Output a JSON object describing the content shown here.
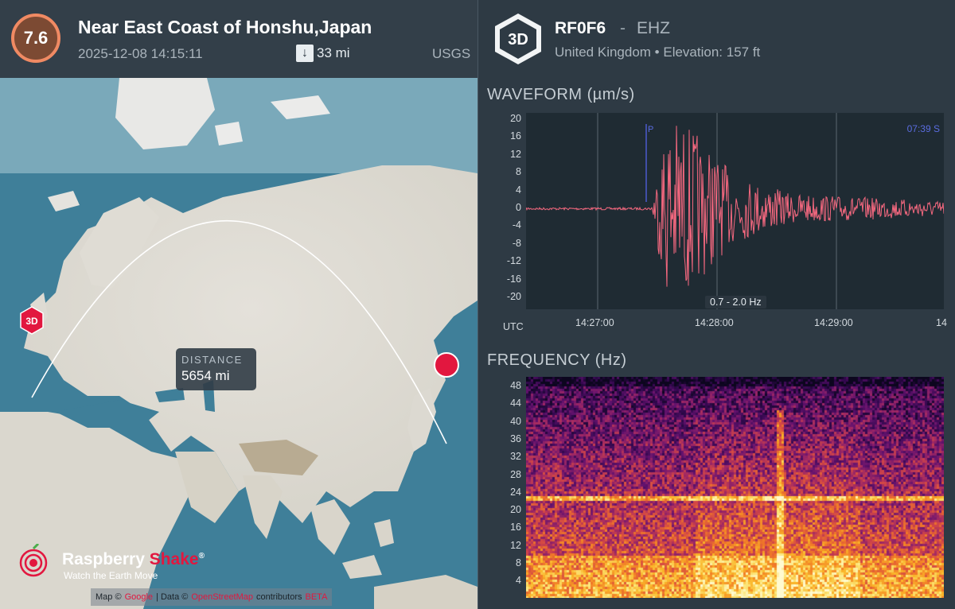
{
  "quake": {
    "magnitude": "7.6",
    "title": "Near East Coast of Honshu,Japan",
    "time": "2025-12-08 14:15:11",
    "depth": "33 mi",
    "depth_icon": "down-arrow-icon",
    "source": "USGS"
  },
  "map": {
    "distance_label": "DISTANCE",
    "distance_value": "5654 mi",
    "station_marker_label": "3D",
    "attribution": {
      "prefix": "Map ©",
      "provider": "Google",
      "middle": "| Data ©",
      "osm": "OpenStreetMap",
      "suffix": "contributors",
      "end": "BETA"
    }
  },
  "brand": {
    "name_part1": "Raspberry ",
    "name_part2": "Shake",
    "reg": "®",
    "tagline": "Watch the Earth Move",
    "icon": "raspberry-shake-logo-icon"
  },
  "station": {
    "badge": "3D",
    "code": "RF0F6",
    "separator": "-",
    "channel": "EHZ",
    "location_line": "United Kingdom • Elevation: 157 ft"
  },
  "waveform": {
    "title": "WAVEFORM (µm/s)",
    "y_ticks": [
      "20",
      "16",
      "12",
      "8",
      "4",
      "0",
      "-4",
      "-8",
      "-12",
      "-16",
      "-20"
    ],
    "x_ticks": [
      "14:27:00",
      "14:28:00",
      "14:29:00",
      "14"
    ],
    "timezone": "UTC",
    "p_label": "P",
    "s_label": "07:39  S",
    "filter": "0.7 - 2.0 Hz",
    "wave_color": "#f4687f"
  },
  "frequency": {
    "title": "FREQUENCY (Hz)",
    "y_ticks": [
      "48",
      "44",
      "40",
      "36",
      "32",
      "28",
      "24",
      "20",
      "16",
      "12",
      "8",
      "4"
    ]
  },
  "colors": {
    "magnitude_ring": "#f08a63",
    "magnitude_fill": "#7c4a33",
    "quake_marker": "#e2173f",
    "panel_bg": "#2e3a44"
  }
}
